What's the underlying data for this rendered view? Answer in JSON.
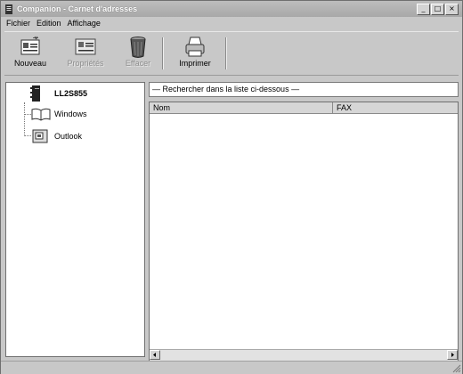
{
  "window": {
    "title": "Companion - Carnet d'adresses",
    "buttons": [
      "_",
      "□",
      "×"
    ]
  },
  "menu": [
    "Fichier",
    "Edition",
    "Affichage"
  ],
  "toolbar": {
    "buttons": [
      {
        "label": "Nouveau",
        "icon": "new-contact-icon",
        "enabled": true
      },
      {
        "label": "Propriétés",
        "icon": "properties-card-icon",
        "enabled": false
      },
      {
        "label": "Effacer",
        "icon": "trash-icon",
        "enabled": false
      },
      {
        "label": "Imprimer",
        "icon": "printer-icon",
        "enabled": true
      }
    ]
  },
  "tree": {
    "root": {
      "label": "LL2S855",
      "icon": "address-book-icon"
    },
    "children": [
      {
        "label": "Windows",
        "icon": "open-book-icon"
      },
      {
        "label": "Outlook",
        "icon": "outlook-card-icon"
      }
    ]
  },
  "search": {
    "label": "— Rechercher dans la liste ci-dessous —"
  },
  "list": {
    "columns": [
      "Nom",
      "FAX"
    ],
    "rows": []
  }
}
